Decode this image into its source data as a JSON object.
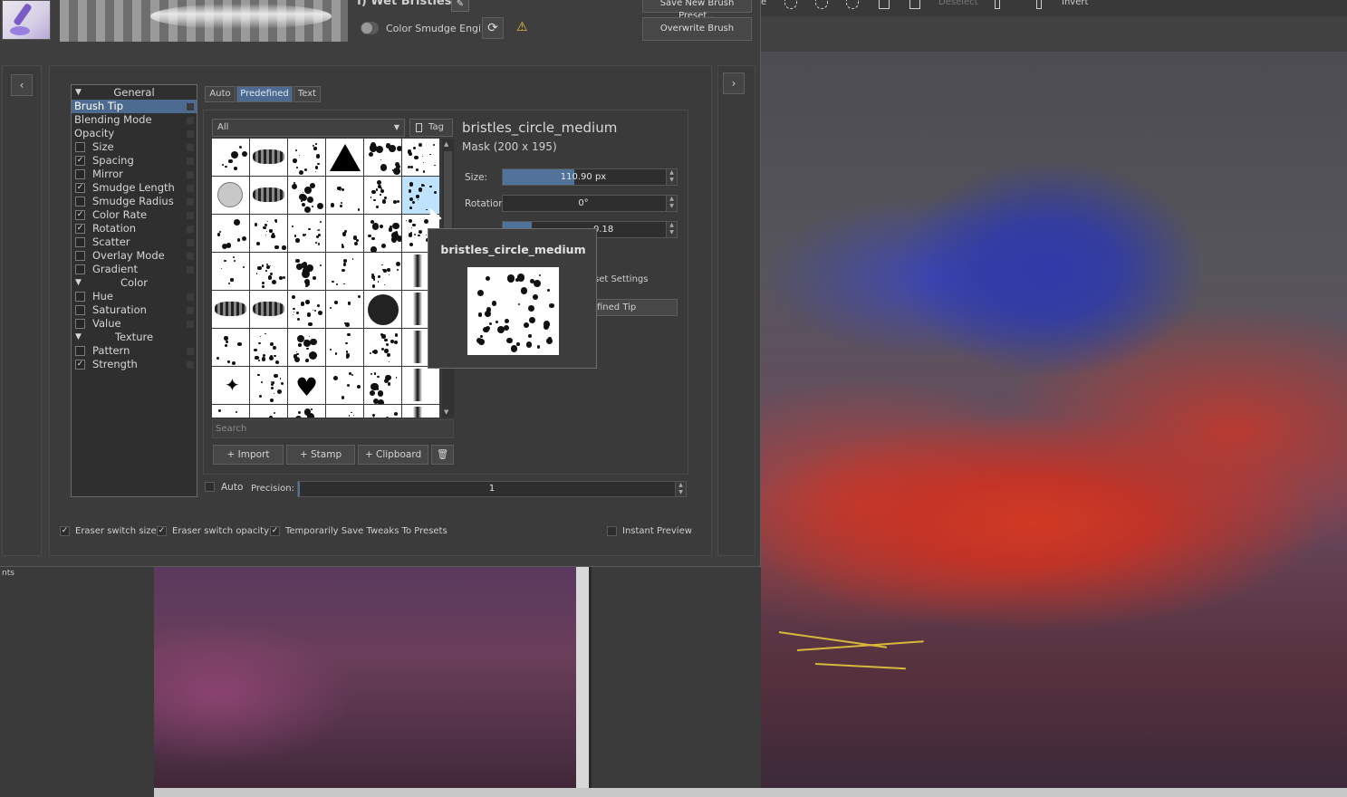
{
  "preset": {
    "name": "I) Wet Bristles",
    "smudge_engine_label": "Color Smudge Engine",
    "save_new_label": "Save New Brush Preset...",
    "overwrite_label": "Overwrite Brush"
  },
  "options": {
    "items": [
      {
        "label": "General",
        "type": "header"
      },
      {
        "label": "Brush Tip",
        "type": "plain",
        "selected": true
      },
      {
        "label": "Blending Mode",
        "type": "plain"
      },
      {
        "label": "Opacity",
        "type": "plain"
      },
      {
        "label": "Size",
        "type": "check",
        "checked": false
      },
      {
        "label": "Spacing",
        "type": "check",
        "checked": true
      },
      {
        "label": "Mirror",
        "type": "check",
        "checked": false
      },
      {
        "label": "Smudge Length",
        "type": "check",
        "checked": true
      },
      {
        "label": "Smudge Radius",
        "type": "check",
        "checked": false
      },
      {
        "label": "Color Rate",
        "type": "check",
        "checked": true
      },
      {
        "label": "Rotation",
        "type": "check",
        "checked": true
      },
      {
        "label": "Scatter",
        "type": "check",
        "checked": false
      },
      {
        "label": "Overlay Mode",
        "type": "check",
        "checked": false
      },
      {
        "label": "Gradient",
        "type": "check",
        "checked": false
      },
      {
        "label": "Color",
        "type": "header"
      },
      {
        "label": "Hue",
        "type": "check",
        "checked": false
      },
      {
        "label": "Saturation",
        "type": "check",
        "checked": false
      },
      {
        "label": "Value",
        "type": "check",
        "checked": false
      },
      {
        "label": "Texture",
        "type": "header"
      },
      {
        "label": "Pattern",
        "type": "check",
        "checked": false
      },
      {
        "label": "Strength",
        "type": "check",
        "checked": true
      }
    ]
  },
  "tip": {
    "tabs": [
      "Auto",
      "Predefined",
      "Text"
    ],
    "active_tab": "Predefined",
    "tag_filter": "All",
    "tag_button": "Tag",
    "search_placeholder": "Search",
    "import_label": "Import",
    "stamp_label": "Stamp",
    "clipboard_label": "Clipboard",
    "selected_name": "bristles_circle_medium",
    "mask_info": "Mask (200 x 195)",
    "size_label": "Size:",
    "size_value": "110.90 px",
    "size_fraction": 0.44,
    "rotation_label": "Rotation:",
    "rotation_value": "0°",
    "third_value": "0.18",
    "third_fraction": 0.18,
    "partial_settings": "set Settings",
    "partial_tip": "fined Tip"
  },
  "tooltip": {
    "title": "bristles_circle_medium"
  },
  "precision": {
    "auto_label": "Auto",
    "label": "Precision:",
    "value": "1"
  },
  "bottom": {
    "eraser_size": "Eraser switch size",
    "eraser_opacity": "Eraser switch opacity",
    "temp_save": "Temporarily Save Tweaks To Presets",
    "instant_preview": "Instant Preview"
  },
  "toolbar": {
    "deselect": "Deselect",
    "invert": "Invert"
  },
  "left_dock": {
    "partial_text": "nts"
  }
}
